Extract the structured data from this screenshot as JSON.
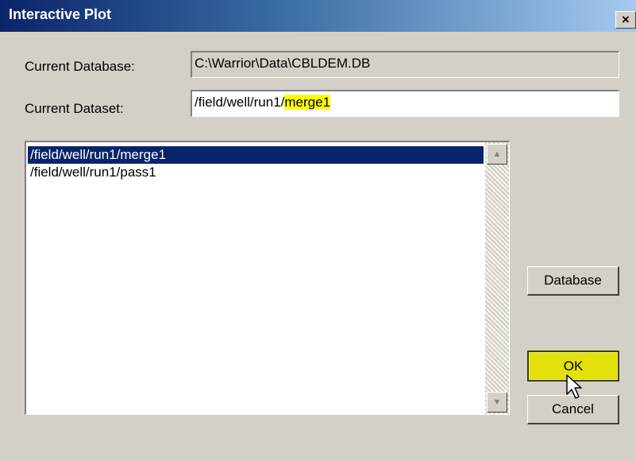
{
  "window": {
    "title": "Interactive Plot",
    "close_label": "×"
  },
  "database": {
    "label": "Current Database:",
    "value": "C:\\Warrior\\Data\\CBLDEM.DB"
  },
  "dataset": {
    "label": "Current Dataset:",
    "value_prefix": "/field/well/run1/",
    "value_highlight": "merge1"
  },
  "datasets_list": {
    "items": [
      {
        "label": "/field/well/run1/merge1",
        "selected": true
      },
      {
        "label": "/field/well/run1/pass1",
        "selected": false
      }
    ],
    "scroll_up_icon": "▲",
    "scroll_down_icon": "▼"
  },
  "buttons": {
    "database_label": "Database",
    "ok_label": "OK",
    "cancel_label": "Cancel"
  },
  "colors": {
    "title_bar": "#0a246a",
    "selection": "#0a246a",
    "highlight": "#ffff00",
    "ok_button": "#e2e20a",
    "dialog_bg": "#d4d0c8"
  },
  "cursor_icon": "arrow-pointer"
}
